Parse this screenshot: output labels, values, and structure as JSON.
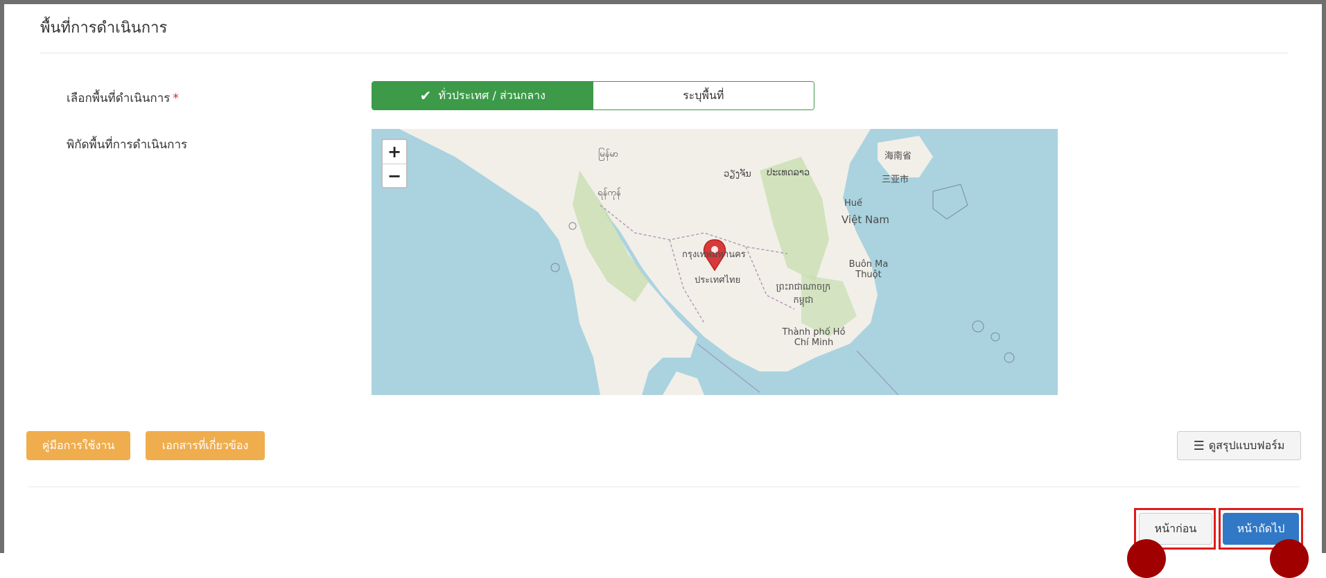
{
  "section": {
    "title": "พื้นที่การดำเนินการ"
  },
  "form": {
    "area_label": "เลือกพื้นที่ดำเนินการ",
    "required_mark": "*",
    "coords_label": "พิกัดพื้นที่การดำเนินการ",
    "toggle": {
      "option_national": "ทั่วประเทศ / ส่วนกลาง",
      "option_specific": "ระบุพื้นที่",
      "selected": "option_national"
    }
  },
  "map": {
    "zoom_in": "+",
    "zoom_out": "−",
    "labels": {
      "myanmar_yangon_area": "မြန်မာ",
      "naypyidaw": "ရန်ကုန်",
      "thai_capital": "กรุงเทพมหานคร",
      "thailand": "ประเทศไทย",
      "vietnam": "Việt Nam",
      "hue": "Huế",
      "cambodia": "ព្រះរាជាណាចក្រ កម្ពុជា",
      "buon_ma_thuot": "Buôn Ma Thuột",
      "hcmc": "Thành phố Hồ Chí Minh",
      "laos": "ປະເທດລາວ",
      "hainan": "海南省",
      "sanya": "三亚市",
      "vientiane": "ວຽງຈັນ"
    },
    "colors": {
      "water": "#aad3df",
      "land": "#f2efe9",
      "forest": "#c8dfb0",
      "marker": "#d83a3a"
    }
  },
  "actions": {
    "manual": "คู่มือการใช้งาน",
    "documents": "เอกสารที่เกี่ยวข้อง",
    "summary": "ดูสรุปแบบฟอร์ม",
    "prev": "หน้าก่อน",
    "next": "หน้าถัดไป"
  }
}
